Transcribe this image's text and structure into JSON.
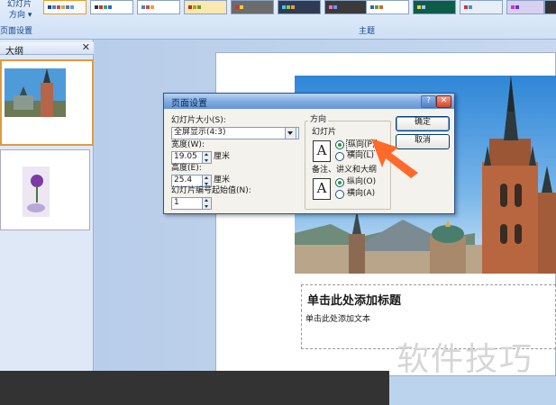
{
  "ribbon": {
    "slide_size_label": "幻灯片",
    "orientation_label": "方向",
    "page_setup_group": "页面设置",
    "themes_group": "主题"
  },
  "outline_pane": {
    "tab_label": "大纲"
  },
  "dialog": {
    "title": "页面设置",
    "size_label": "幻灯片大小(S):",
    "size_value": "全屏显示(4:3)",
    "width_label": "宽度(W):",
    "width_value": "19.05",
    "height_label": "高度(E):",
    "height_value": "25.4",
    "unit": "厘米",
    "start_number_label": "幻灯片编号起始值(N):",
    "start_number_value": "1",
    "orientation_group": "方向",
    "slides_label": "幻灯片",
    "notes_label": "备注、讲义和大纲",
    "portrait_slides": "纵向(P)",
    "landscape_slides": "横向(L)",
    "portrait_notes": "纵向(O)",
    "landscape_notes": "横向(A)",
    "ok": "确定",
    "cancel": "取消",
    "help": "?",
    "close": "✕"
  },
  "slide": {
    "title_placeholder": "单击此处添加标题",
    "text_placeholder": "单击此处添加文本"
  },
  "watermark": "软件技巧",
  "colors": {
    "accent": "#ff6a2b",
    "dialog_title": "#6595d6"
  }
}
